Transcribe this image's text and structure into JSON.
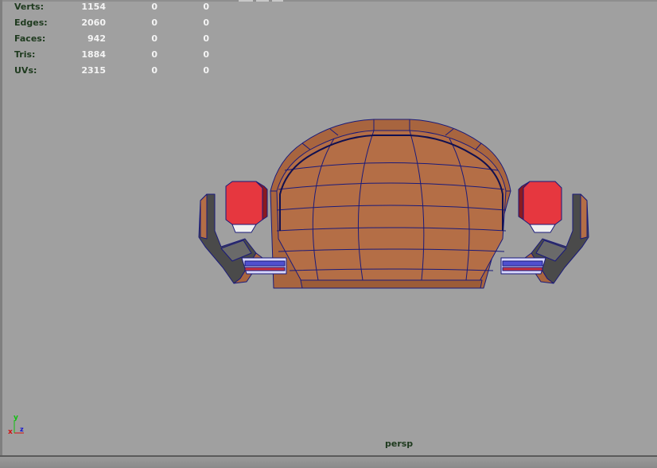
{
  "hud": {
    "rows": [
      {
        "label": "Verts:",
        "v1": "1154",
        "v2": "0",
        "v3": "0"
      },
      {
        "label": "Edges:",
        "v1": "2060",
        "v2": "0",
        "v3": "0"
      },
      {
        "label": "Faces:",
        "v1": "942",
        "v2": "0",
        "v3": "0"
      },
      {
        "label": "Tris:",
        "v1": "1884",
        "v2": "0",
        "v3": "0"
      },
      {
        "label": "UVs:",
        "v1": "2315",
        "v2": "0",
        "v3": "0"
      }
    ]
  },
  "viewport": {
    "camera": "persp",
    "background_color": "#a0a0a0"
  },
  "axis": {
    "x": "x",
    "y": "y",
    "z": "z"
  },
  "colors": {
    "body": "#b46e46",
    "wire": "#1a1a7a",
    "red_block": "#e6373f",
    "axis_x": "#d01010",
    "axis_y": "#10c010",
    "axis_z": "#1010d0"
  }
}
